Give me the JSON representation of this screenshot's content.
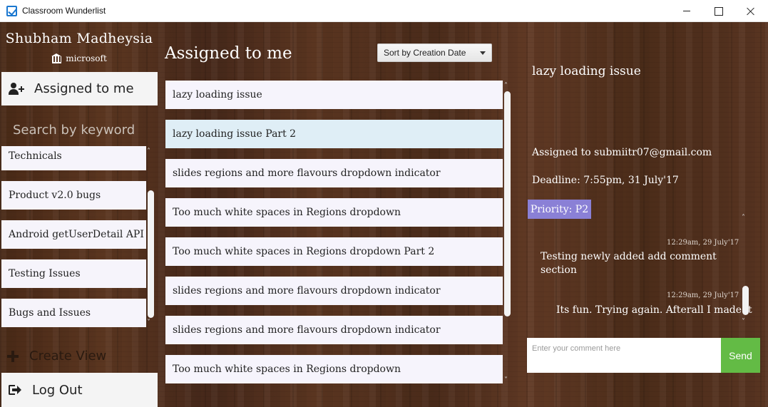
{
  "window": {
    "title": "Classroom Wunderlist",
    "controls": [
      "minimize",
      "maximize",
      "close"
    ]
  },
  "sidebar": {
    "user_name": "Shubham Madheysia",
    "org_icon": "bank-icon",
    "org": "microsoft",
    "assigned_label": "Assigned to me",
    "assigned_icon": "user-plus-icon",
    "search_placeholder": "Search by keyword",
    "views": [
      {
        "label": "Technicals"
      },
      {
        "label": "Product v2.0 bugs"
      },
      {
        "label": "Android getUserDetail API"
      },
      {
        "label": "Testing Issues"
      },
      {
        "label": "Bugs and Issues"
      }
    ],
    "create_view_label": "Create View",
    "create_view_icon": "plus-icon",
    "logout_label": "Log Out",
    "logout_icon": "sign-out-icon"
  },
  "main": {
    "heading": "Assigned to me",
    "sort_selected": "Sort by Creation Date",
    "tasks": [
      {
        "title": "lazy loading issue"
      },
      {
        "title": "lazy loading issue Part 2",
        "selected": true
      },
      {
        "title": "slides regions and more flavours dropdown indicator"
      },
      {
        "title": "Too much white spaces in Regions dropdown"
      },
      {
        "title": "Too much white spaces in Regions dropdown Part 2"
      },
      {
        "title": "slides regions and more flavours dropdown indicator"
      },
      {
        "title": "slides regions and more flavours dropdown indicator"
      },
      {
        "title": "Too much white spaces in Regions dropdown"
      }
    ]
  },
  "detail": {
    "title": "lazy loading issue",
    "assigned_to": "Assigned to submiitr07@gmail.com",
    "deadline": "Deadline: 7:55pm, 31 July'17",
    "priority": "Priority: P2",
    "comments": [
      {
        "time": "12:29am, 29 July'17",
        "text": "Testing newly added add comment section"
      },
      {
        "time": "12:29am, 29 July'17",
        "text": "Its fun. Trying again. Afterall I made it"
      }
    ],
    "comment_placeholder": "Enter your comment here",
    "send_label": "Send"
  },
  "colors": {
    "priority_bg": "#8a80d6",
    "send_bg": "#63bb45",
    "selected_task_bg": "#dfeef6",
    "wood_base": "#4f2e1b"
  }
}
